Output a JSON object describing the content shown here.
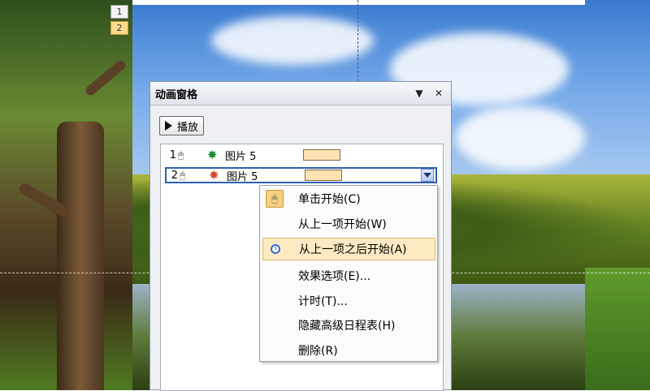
{
  "slide": {
    "tags": [
      "1",
      "2"
    ]
  },
  "pane": {
    "title": "动画窗格",
    "dropdown_icon": "triangle-down",
    "close_icon": "close",
    "play_label": "播放",
    "items": [
      {
        "number": "1",
        "trigger_icon": "mouse-icon",
        "effect_icon": "star-green",
        "name": "图片 5"
      },
      {
        "number": "2",
        "trigger_icon": "mouse-icon",
        "effect_icon": "star-red",
        "name": "图片 5",
        "selected": true
      }
    ]
  },
  "context_menu": {
    "items": [
      {
        "label": "单击开始(C)",
        "icon": "mouse-icon"
      },
      {
        "label": "从上一项开始(W)"
      },
      {
        "label": "从上一项之后开始(A)",
        "icon": "clock-icon",
        "highlighted": true
      },
      {
        "label": "效果选项(E)..."
      },
      {
        "label": "计时(T)..."
      },
      {
        "label": "隐藏高级日程表(H)"
      },
      {
        "label": "删除(R)"
      }
    ]
  },
  "colors": {
    "highlight": "#fdeac3",
    "selection_border": "#2f5fb0",
    "timeline_bar": "#ffe2b2"
  }
}
